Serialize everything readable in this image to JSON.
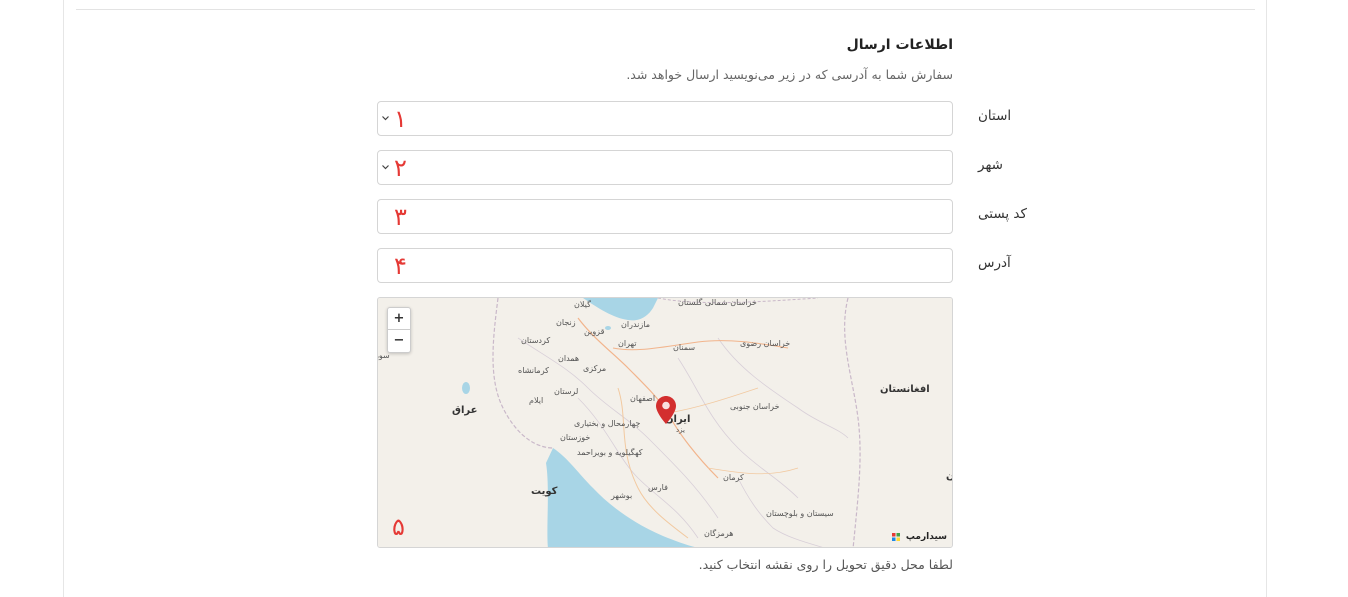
{
  "section": {
    "title": "اطلاعات ارسال",
    "subtitle": "سفارش شما به آدرسی که در زیر می‌نویسید ارسال خواهد شد."
  },
  "fields": {
    "province": {
      "label": "استان",
      "marker": "۱"
    },
    "city": {
      "label": "شهر",
      "marker": "۲"
    },
    "postal_code": {
      "label": "کد پستی",
      "marker": "۳"
    },
    "address": {
      "label": "آدرس",
      "marker": "۴"
    }
  },
  "map": {
    "zoom_in": "+",
    "zoom_out": "−",
    "marker": "۵",
    "attribution": "سیدارمپ",
    "labels": {
      "gilan": "گیلان",
      "golestan": "خراسان شمالی گلستان",
      "zanjan": "زنجان",
      "qazvin": "قزوین",
      "mazandaran": "مازندران",
      "kurdistan": "کردستان",
      "tehran": "تهران",
      "semnan": "سمنان",
      "razavi": "خراسان رضوی",
      "hamedan": "همدان",
      "kermanshah": "کرمانشاه",
      "markazi": "مرکزی",
      "sur": "سور",
      "lorestan": "لرستان",
      "isfahan": "اصفهان",
      "ilam": "ایلام",
      "iraq": "عراق",
      "chaharmahal": "چهارمحال و بختیاری",
      "iran": "ایران",
      "yazd": "یزد",
      "south_khorasan": "خراسان جنوبی",
      "afghanistan": "افغانستان",
      "khuzestan": "خوزستان",
      "kohgiluyeh": "کهگیلویه و بویراحمد",
      "kerman": "کرمان",
      "kuwait": "کویت",
      "fars": "فارس",
      "bushehr": "بوشهر",
      "sistan": "سیستان و بلوچستان",
      "hormozgan": "هرمزگان",
      "edge_n": "ن"
    }
  },
  "hint": "لطفا محل دقیق تحویل را روی نقشه انتخاب کنید.",
  "colors": {
    "marker_red": "#e53935",
    "pin_red": "#d32f2f",
    "water": "#a8d5e6"
  }
}
